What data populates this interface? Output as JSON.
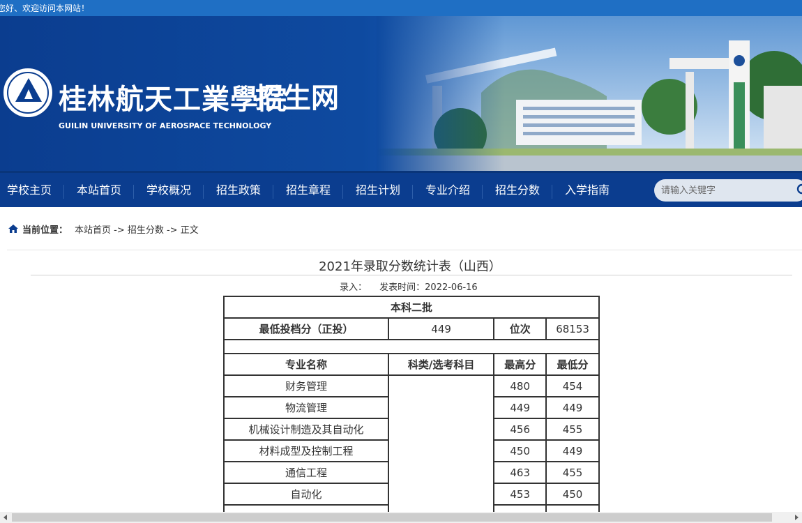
{
  "topbar": {
    "welcome": "您好、欢迎访问本网站！"
  },
  "header": {
    "name_cn": "桂林航天工業學院",
    "name_en": "GUILIN UNIVERSITY OF AEROSPACE TECHNOLOGY",
    "site_title": "招生网"
  },
  "nav": {
    "items": [
      "学校主页",
      "本站首页",
      "学校概况",
      "招生政策",
      "招生章程",
      "招生计划",
      "专业介绍",
      "招生分数",
      "入学指南"
    ],
    "search_placeholder": "请输入关键字"
  },
  "breadcrumb": {
    "label": "当前位置：",
    "path": "本站首页 -> 招生分数 -> 正文"
  },
  "article": {
    "title": "2021年录取分数统计表（山西）",
    "author_label": "录入：",
    "date": "发表时间：2022-06-16"
  },
  "table": {
    "batch": "本科二批",
    "min_score_label": "最低投档分（正投）",
    "min_score": "449",
    "rank_label": "位次",
    "rank": "68153",
    "headers": [
      "专业名称",
      "科类/选考科目",
      "最高分",
      "最低分"
    ],
    "rows": [
      {
        "major": "财务管理",
        "max": "480",
        "min": "454"
      },
      {
        "major": "物流管理",
        "max": "449",
        "min": "449"
      },
      {
        "major": "机械设计制造及其自动化",
        "max": "456",
        "min": "455"
      },
      {
        "major": "材料成型及控制工程",
        "max": "450",
        "min": "449"
      },
      {
        "major": "通信工程",
        "max": "463",
        "min": "455"
      },
      {
        "major": "自动化",
        "max": "453",
        "min": "450"
      }
    ]
  },
  "colors": {
    "nav_bg": "#0b3d8f",
    "topbar_bg": "#1f6fc4"
  }
}
